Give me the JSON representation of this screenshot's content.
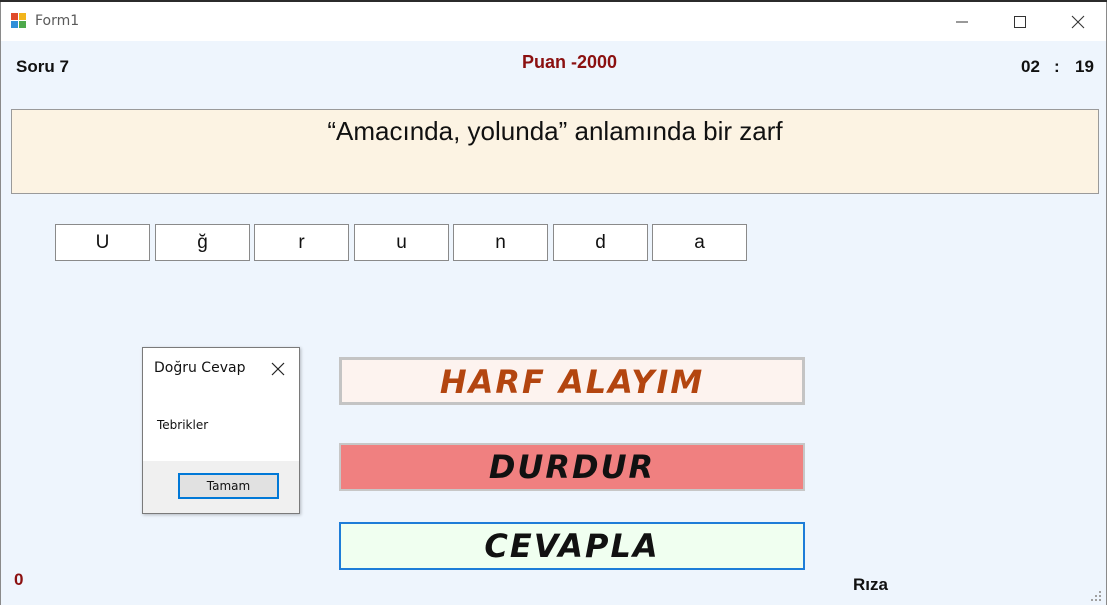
{
  "window": {
    "title": "Form1",
    "minimize_icon": "minimize-icon",
    "maximize_icon": "maximize-icon",
    "close_icon": "close-icon"
  },
  "header": {
    "question_number": "Soru 7",
    "score": "Puan -2000",
    "timer_minutes": "02",
    "timer_separator": ":",
    "timer_seconds": "19"
  },
  "question": {
    "text": "“Amacında, yolunda” anlamında bir zarf"
  },
  "answer_letters": [
    "U",
    "ğ",
    "r",
    "u",
    "n",
    "d",
    "a"
  ],
  "buttons": {
    "harf": "HARF ALAYIM",
    "durdur": "DURDUR",
    "cevapla": "CEVAPLA"
  },
  "dialog": {
    "title": "Doğru Cevap",
    "message": "Tebrikler",
    "ok_label": "Tamam"
  },
  "footer": {
    "counter": "0",
    "name": "Rıza"
  },
  "colors": {
    "score": "#8b1010",
    "harf_text": "#b3450f",
    "durdur_bg": "#f08080",
    "cevapla_bg": "#f0fff0",
    "question_bg": "#fcf3e3",
    "form_bg": "#eef5fd"
  }
}
